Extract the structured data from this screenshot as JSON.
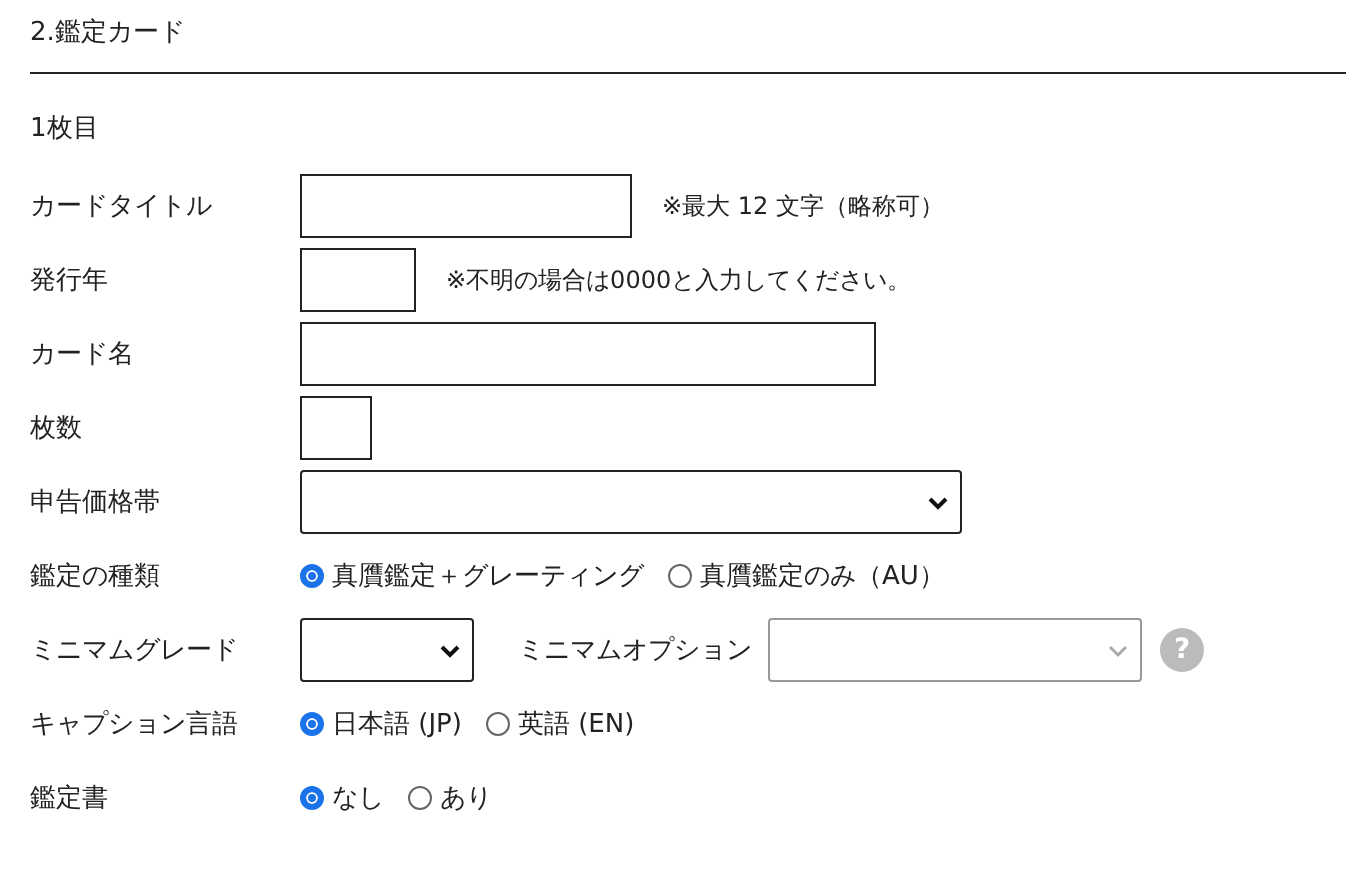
{
  "section_title": "2.鑑定カード",
  "card_heading": "1枚目",
  "rows": [
    {
      "kind": "text",
      "label": "カードタイトル",
      "note": "※最大 12 文字（略称可）"
    },
    {
      "kind": "text",
      "label": "発行年",
      "note": "※不明の場合は0000と入力してください。"
    },
    {
      "kind": "text",
      "label": "カード名"
    },
    {
      "kind": "text",
      "label": "枚数"
    },
    {
      "kind": "select",
      "label": "申告価格帯"
    },
    {
      "kind": "radio",
      "label": "鑑定の種類",
      "options": [
        {
          "label": "真贋鑑定＋グレーティング",
          "selected": true
        },
        {
          "label": "真贋鑑定のみ（AU）",
          "selected": false
        }
      ]
    },
    {
      "kind": "grade",
      "label": "ミニマムグレード",
      "option_label": "ミニマムオプション",
      "option_disabled": true,
      "help": "?"
    },
    {
      "kind": "radio",
      "label": "キャプション言語",
      "options": [
        {
          "label": "日本語 (JP)",
          "selected": true
        },
        {
          "label": "英語 (EN)",
          "selected": false
        }
      ]
    },
    {
      "kind": "radio",
      "label": "鑑定書",
      "options": [
        {
          "label": "なし",
          "selected": true
        },
        {
          "label": "あり",
          "selected": false
        }
      ]
    }
  ]
}
